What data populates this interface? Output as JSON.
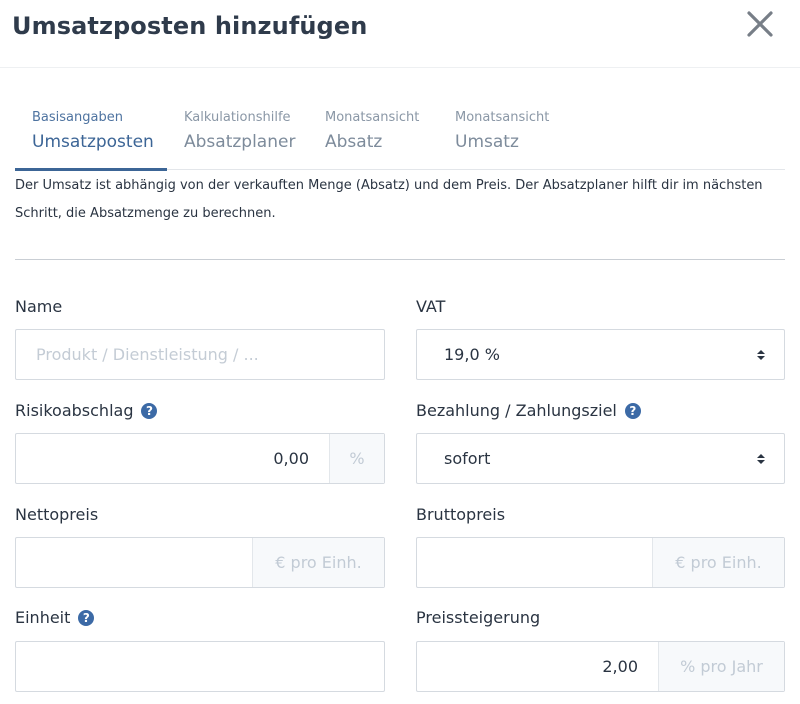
{
  "modal": {
    "title": "Umsatzposten hinzufügen"
  },
  "tabs": [
    {
      "sub": "Basisangaben",
      "main": "Umsatzposten",
      "active": true
    },
    {
      "sub": "Kalkulationshilfe",
      "main": "Absatzplaner",
      "active": false
    },
    {
      "sub": "Monatsansicht",
      "main": "Absatz",
      "active": false
    },
    {
      "sub": "Monatsansicht",
      "main": "Umsatz",
      "active": false
    }
  ],
  "intro_text": "Der Umsatz ist abhängig von der verkauften Menge (Absatz) und dem Preis. Der Absatzplaner hilft dir im nächsten Schritt, die Absatzmenge zu berechnen.",
  "form": {
    "name": {
      "label": "Name",
      "value": "",
      "placeholder": "Produkt / Dienstleistung / ..."
    },
    "vat": {
      "label": "VAT",
      "value": "19,0 %"
    },
    "risikoabschlag": {
      "label": "Risikoabschlag",
      "value": "0,00",
      "addon": "%"
    },
    "bezahlung": {
      "label": "Bezahlung / Zahlungsziel",
      "value": "sofort"
    },
    "nettopreis": {
      "label": "Nettopreis",
      "value": "",
      "addon": "€ pro Einh."
    },
    "bruttopreis": {
      "label": "Bruttopreis",
      "value": "",
      "addon": "€ pro Einh."
    },
    "einheit": {
      "label": "Einheit",
      "value": ""
    },
    "preissteigerung": {
      "label": "Preissteigerung",
      "value": "2,00",
      "addon": "% pro Jahr"
    }
  },
  "help_glyph": "?",
  "icons": {
    "close": "close-icon",
    "help": "question-circle-icon",
    "select": "sort-arrows-icon"
  },
  "colors": {
    "accent": "#3c6596",
    "help": "#3c6aa6",
    "addon_bg": "#f7f9fb"
  }
}
